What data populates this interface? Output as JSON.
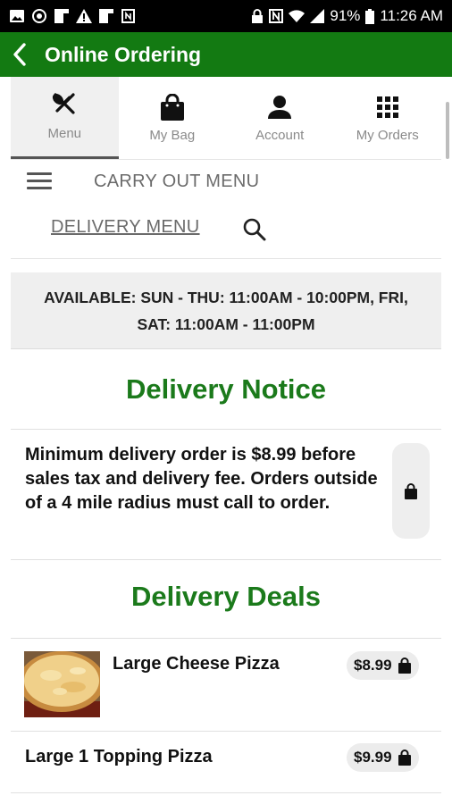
{
  "status_bar": {
    "battery_percent": "91%",
    "time": "11:26 AM",
    "left_icons": [
      "gallery-icon",
      "sync-icon",
      "flipboard-icon",
      "alert-icon",
      "flipboard-icon",
      "nfc-icon"
    ],
    "right_icons": [
      "lock-icon",
      "nfc-icon",
      "wifi-icon",
      "signal-icon",
      "battery-icon"
    ]
  },
  "app_bar": {
    "title": "Online Ordering",
    "color": "#137a12"
  },
  "tabs": [
    {
      "label": "Menu",
      "icon": "utensils-icon",
      "active": true
    },
    {
      "label": "My Bag",
      "icon": "bag-icon",
      "active": false
    },
    {
      "label": "Account",
      "icon": "person-icon",
      "active": false
    },
    {
      "label": "My Orders",
      "icon": "grid-icon",
      "active": false
    }
  ],
  "categories": {
    "carry_out": "CARRY OUT MENU",
    "delivery": "DELIVERY MENU"
  },
  "availability": "AVAILABLE: SUN - THU: 11:00AM - 10:00PM, FRI, SAT: 11:00AM - 11:00PM",
  "sections": {
    "notice_title": "Delivery Notice",
    "notice_text": "Minimum delivery order is $8.99 before sales tax and delivery fee. Orders outside of a 4 mile radius must call to order.",
    "deals_title": "Delivery Deals"
  },
  "items": [
    {
      "name": "Large Cheese Pizza",
      "price": "$8.99",
      "has_image": true
    },
    {
      "name": "Large 1 Topping Pizza",
      "price": "$9.99",
      "has_image": false
    }
  ],
  "colors": {
    "accent_green": "#1b7a1b",
    "header_green": "#137a12"
  }
}
